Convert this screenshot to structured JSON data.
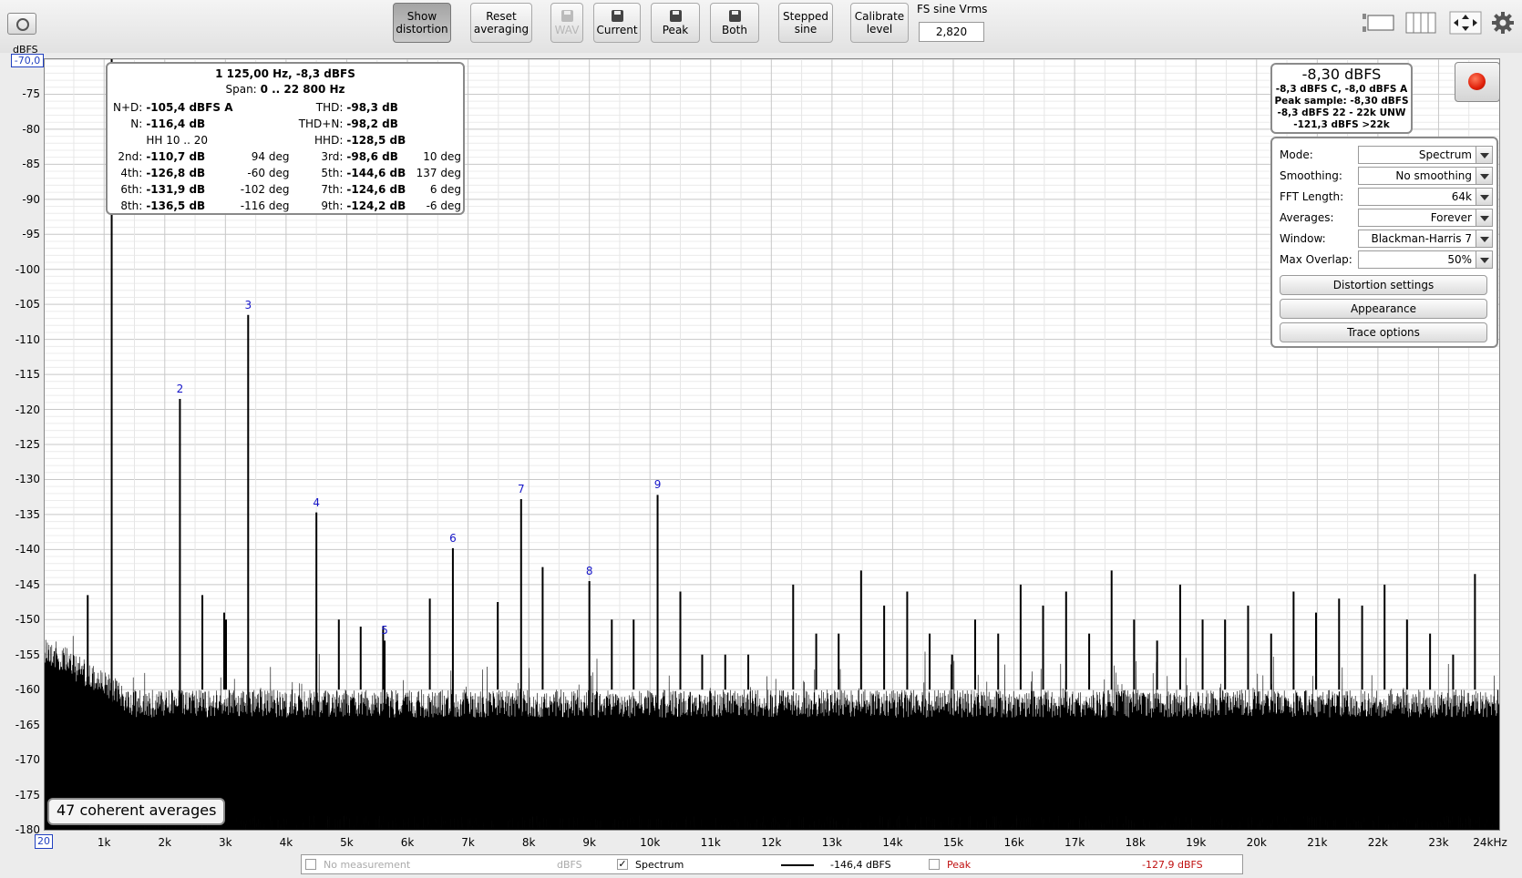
{
  "toolbar": {
    "buttons": [
      {
        "label1": "Show",
        "label2": "distortion"
      },
      {
        "label1": "Reset",
        "label2": "averaging"
      },
      {
        "label1": "WAV"
      },
      {
        "label1": "Current"
      },
      {
        "label1": "Peak"
      },
      {
        "label1": "Both"
      },
      {
        "label1": "Stepped",
        "label2": "sine"
      },
      {
        "label1": "Calibrate",
        "label2": "level"
      }
    ],
    "fs_label": "FS sine Vrms",
    "fs_value": "2,820",
    "icons": [
      "camera-icon",
      "layout-icon",
      "columns-icon",
      "move-arrows-icon",
      "gear-icon"
    ]
  },
  "plot": {
    "y_unit": "dBFS",
    "y_top_value": "-70,0",
    "x_start_value": "20",
    "y_ticks": [
      "-75",
      "-80",
      "-85",
      "-90",
      "-95",
      "-100",
      "-105",
      "-110",
      "-115",
      "-120",
      "-125",
      "-130",
      "-135",
      "-140",
      "-145",
      "-150",
      "-155",
      "-160",
      "-165",
      "-170",
      "-175",
      "-180"
    ],
    "x_ticks": [
      "1k",
      "2k",
      "3k",
      "4k",
      "5k",
      "6k",
      "7k",
      "8k",
      "9k",
      "10k",
      "11k",
      "12k",
      "13k",
      "14k",
      "15k",
      "16k",
      "17k",
      "18k",
      "19k",
      "20k",
      "21k",
      "22k",
      "23k",
      "24kHz"
    ]
  },
  "chart_data": {
    "type": "line",
    "title": "",
    "xlabel": "",
    "ylabel": "dBFS",
    "xlim": [
      20,
      24000
    ],
    "ylim": [
      -180,
      -70
    ],
    "harmonics": [
      {
        "label": "",
        "freq": 1125,
        "level": -8.3
      },
      {
        "label": "2",
        "freq": 2250,
        "level": -118.5
      },
      {
        "label": "3",
        "freq": 3375,
        "level": -106.5
      },
      {
        "label": "4",
        "freq": 4500,
        "level": -134.7
      },
      {
        "label": "5",
        "freq": 5625,
        "level": -153
      },
      {
        "label": "6",
        "freq": 6750,
        "level": -139.8
      },
      {
        "label": "7",
        "freq": 7875,
        "level": -132.8
      },
      {
        "label": "8",
        "freq": 9000,
        "level": -144.5
      },
      {
        "label": "9",
        "freq": 10125,
        "level": -132.2
      }
    ],
    "spurs": [
      {
        "freq": 730,
        "level": -146.5
      },
      {
        "freq": 2620,
        "level": -146.5
      },
      {
        "freq": 2980,
        "level": -149
      },
      {
        "freq": 3010,
        "level": -150
      },
      {
        "freq": 4870,
        "level": -150
      },
      {
        "freq": 5230,
        "level": -151
      },
      {
        "freq": 5600,
        "level": -151
      },
      {
        "freq": 6370,
        "level": -147
      },
      {
        "freq": 7490,
        "level": -147.5
      },
      {
        "freq": 8230,
        "level": -142.5
      },
      {
        "freq": 9370,
        "level": -150
      },
      {
        "freq": 9730,
        "level": -150
      },
      {
        "freq": 10500,
        "level": -146
      },
      {
        "freq": 10860,
        "level": -155
      },
      {
        "freq": 11240,
        "level": -155
      },
      {
        "freq": 11620,
        "level": -155
      },
      {
        "freq": 12360,
        "level": -145
      },
      {
        "freq": 12740,
        "level": -152
      },
      {
        "freq": 13110,
        "level": -152
      },
      {
        "freq": 13480,
        "level": -143
      },
      {
        "freq": 13860,
        "level": -148
      },
      {
        "freq": 14240,
        "level": -146
      },
      {
        "freq": 14610,
        "level": -152
      },
      {
        "freq": 14980,
        "level": -155
      },
      {
        "freq": 15360,
        "level": -150
      },
      {
        "freq": 15740,
        "level": -152
      },
      {
        "freq": 16110,
        "level": -145
      },
      {
        "freq": 16480,
        "level": -148
      },
      {
        "freq": 16860,
        "level": -146
      },
      {
        "freq": 17240,
        "level": -152
      },
      {
        "freq": 17610,
        "level": -143
      },
      {
        "freq": 17980,
        "level": -150
      },
      {
        "freq": 18360,
        "level": -153
      },
      {
        "freq": 18740,
        "level": -145
      },
      {
        "freq": 19110,
        "level": -150
      },
      {
        "freq": 19480,
        "level": -150
      },
      {
        "freq": 19860,
        "level": -148
      },
      {
        "freq": 20240,
        "level": -152
      },
      {
        "freq": 20610,
        "level": -146
      },
      {
        "freq": 20980,
        "level": -149
      },
      {
        "freq": 21360,
        "level": -147
      },
      {
        "freq": 21740,
        "level": -148
      },
      {
        "freq": 22110,
        "level": -145
      },
      {
        "freq": 22480,
        "level": -150
      },
      {
        "freq": 22860,
        "level": -152
      },
      {
        "freq": 23240,
        "level": -155
      },
      {
        "freq": 23600,
        "level": -143.5
      }
    ],
    "noise_floor_db": [
      -160,
      -178
    ],
    "series": [
      {
        "name": "Spectrum",
        "color": "#000000"
      },
      {
        "name": "Peak",
        "color": "#c01010"
      }
    ]
  },
  "info": {
    "header": "1 125,00 Hz, -8,3 dBFS",
    "span_label": "Span:",
    "span_value": "0 .. 22 800 Hz",
    "hh_label": "HH 10 .. 20",
    "rows": [
      {
        "l1": "N+D:",
        "v1": "-105,4 dBFS A",
        "p1": "",
        "l2": "THD:",
        "v2": "-98,3 dB",
        "p2": ""
      },
      {
        "l1": "N:",
        "v1": "-116,4 dB",
        "p1": "",
        "l2": "THD+N:",
        "v2": "-98,2 dB",
        "p2": ""
      },
      {
        "l1": "",
        "v1": "",
        "p1": "",
        "l2": "HHD:",
        "v2": "-128,5 dB",
        "p2": ""
      },
      {
        "l1": "2nd:",
        "v1": "-110,7 dB",
        "p1": "94 deg",
        "l2": "3rd:",
        "v2": "-98,6 dB",
        "p2": "10 deg"
      },
      {
        "l1": "4th:",
        "v1": "-126,8 dB",
        "p1": "-60 deg",
        "l2": "5th:",
        "v2": "-144,6 dB",
        "p2": "137 deg"
      },
      {
        "l1": "6th:",
        "v1": "-131,9 dB",
        "p1": "-102 deg",
        "l2": "7th:",
        "v2": "-124,6 dB",
        "p2": "6 deg"
      },
      {
        "l1": "8th:",
        "v1": "-136,5 dB",
        "p1": "-116 deg",
        "l2": "9th:",
        "v2": "-124,2 dB",
        "p2": "-6 deg"
      }
    ]
  },
  "level": {
    "main": "-8,30 dBFS",
    "line1": "-8,3 dBFS C, -8,0 dBFS A",
    "line2": "Peak sample: -8,30 dBFS",
    "line3": "-8,3 dBFS 22 - 22k UNW",
    "line4": "-121,3 dBFS >22k"
  },
  "settings": {
    "rows": [
      {
        "label": "Mode:",
        "value": "Spectrum"
      },
      {
        "label": "Smoothing:",
        "value": "No  smoothing"
      },
      {
        "label": "FFT Length:",
        "value": "64k"
      },
      {
        "label": "Averages:",
        "value": "Forever"
      },
      {
        "label": "Window:",
        "value": "Blackman-Harris 7"
      },
      {
        "label": "Max Overlap:",
        "value": "50%"
      }
    ],
    "buttons": [
      "Distortion settings",
      "Appearance",
      "Trace options"
    ]
  },
  "averages_badge": "47 coherent averages",
  "legend": {
    "no_meas": "No measurement",
    "no_meas_unit": "dBFS",
    "spectrum": "Spectrum",
    "spectrum_value": "-146,4 dBFS",
    "peak": "Peak",
    "peak_value": "-127,9 dBFS",
    "spectrum_checked": "✓"
  },
  "colors": {
    "harmonic_label": "#1515c8",
    "peak": "#c01010",
    "accent_blue": "#2040c0"
  }
}
